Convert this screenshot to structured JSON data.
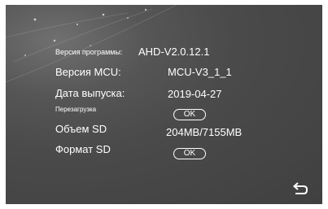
{
  "software_version": {
    "label": "Версия программы:",
    "value": "AHD-V2.0.12.1"
  },
  "mcu_version": {
    "label": "Версия MCU:",
    "value": "MCU-V3_1_1"
  },
  "release_date": {
    "label": "Дата выпуска:",
    "value": "2019-04-27"
  },
  "reboot": {
    "label": "Перезагрузка",
    "button": "OK"
  },
  "sd_capacity": {
    "label": "Объем SD",
    "value": "204MB/7155MB"
  },
  "sd_format": {
    "label": "Формат SD",
    "button": "OK"
  },
  "icons": {
    "back": "back-arrow-icon"
  },
  "colors": {
    "background": "#4a4a4a",
    "text": "#ffffff"
  }
}
